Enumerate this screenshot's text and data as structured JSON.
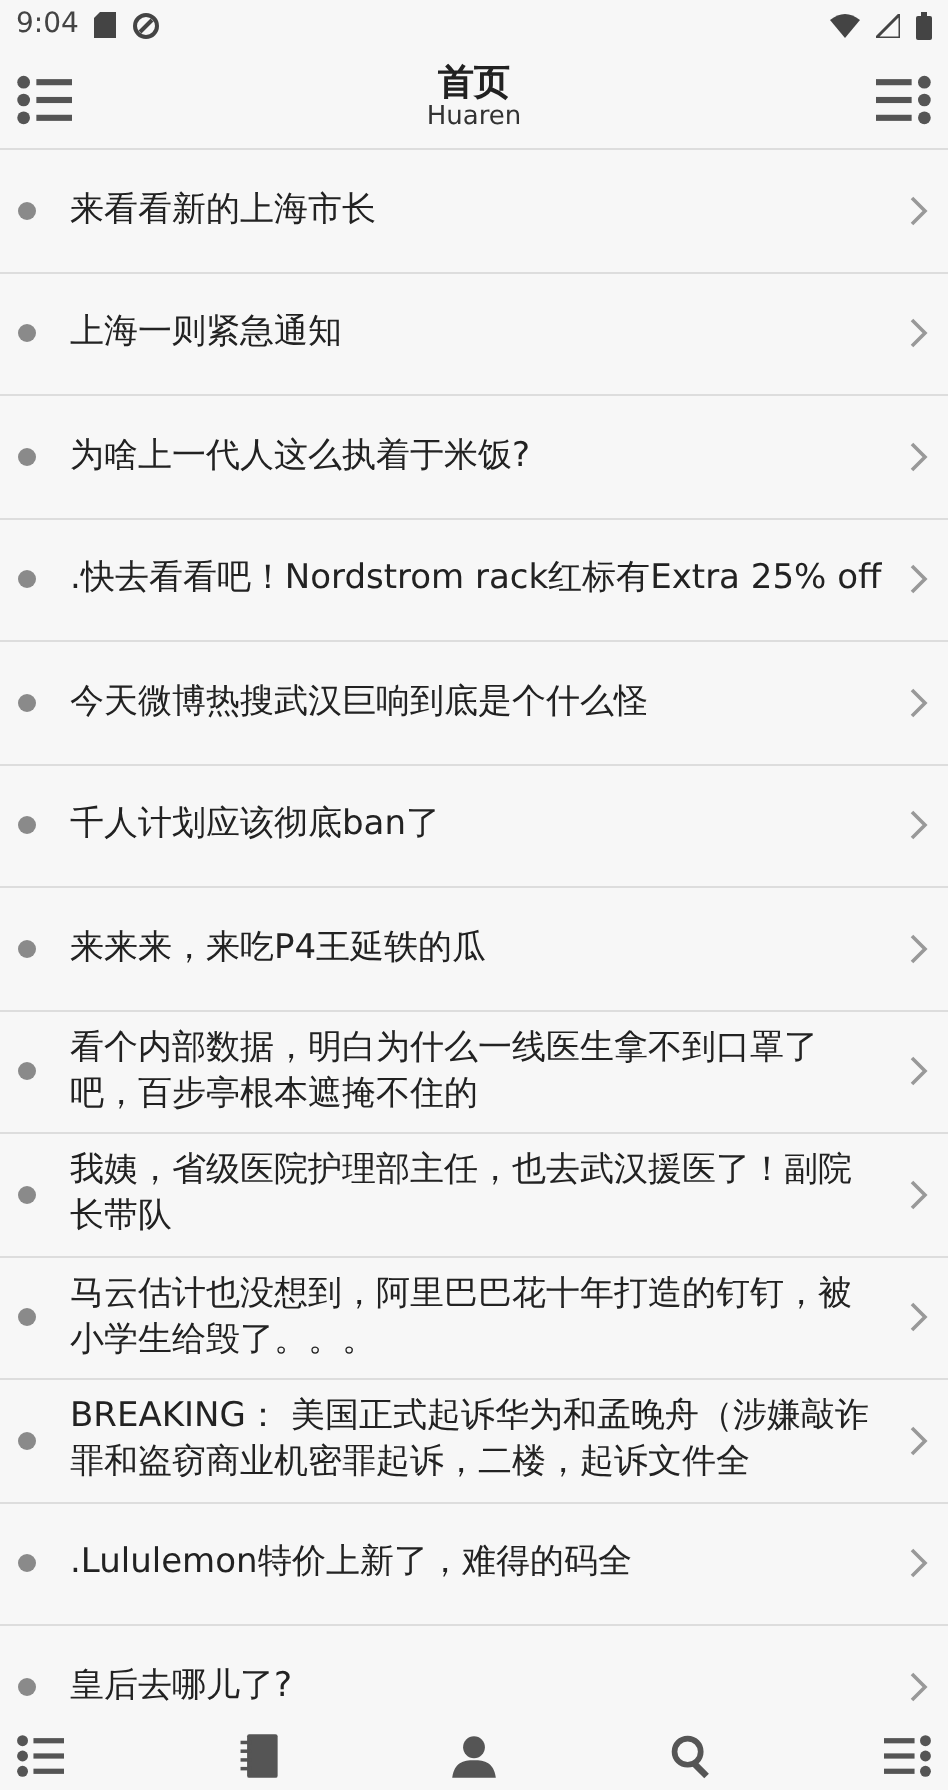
{
  "status_bar": {
    "time": "9:04"
  },
  "header": {
    "title": "首页",
    "subtitle": "Huaren"
  },
  "items": [
    {
      "title": "来看看新的上海市长"
    },
    {
      "title": "上海一则紧急通知"
    },
    {
      "title": "为啥上一代人这么执着于米饭?"
    },
    {
      "title": ".快去看看吧！Nordstrom rack红标有Extra 25% off"
    },
    {
      "title": "今天微博热搜武汉巨响到底是个什么怪"
    },
    {
      "title": "千人计划应该彻底ban了"
    },
    {
      "title": "来来来，来吃P4王延轶的瓜"
    },
    {
      "title": "看个内部数据，明白为什么一线医生拿不到口罩了吧，百步亭根本遮掩不住的"
    },
    {
      "title": "我姨，省级医院护理部主任，也去武汉援医了！副院长带队"
    },
    {
      "title": "马云估计也没想到，阿里巴巴花十年打造的钉钉，被小学生给毁了。。。"
    },
    {
      "title": "BREAKING： 美国正式起诉华为和孟晚舟（涉嫌敲诈罪和盗窃商业机密罪起诉，二楼，起诉文件全"
    },
    {
      "title": ".Lululemon特价上新了，难得的码全"
    },
    {
      "title": "皇后去哪儿了?"
    }
  ],
  "bottom_bar": [
    {
      "kind": "list"
    },
    {
      "kind": "notebook"
    },
    {
      "kind": "person"
    },
    {
      "kind": "search"
    },
    {
      "kind": "menu"
    }
  ]
}
